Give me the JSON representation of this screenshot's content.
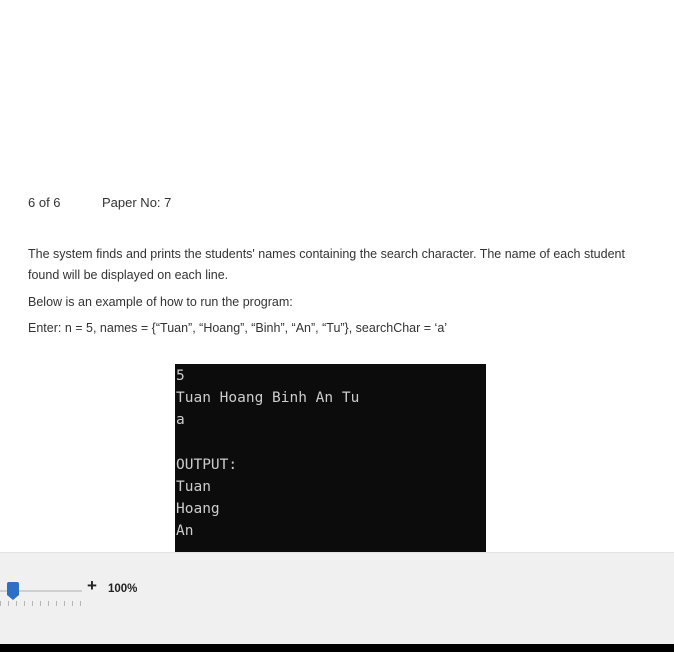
{
  "document": {
    "page_count": "6 of 6",
    "paper_no": "Paper No: 7",
    "description": "The system finds and prints the students' names containing the search character. The name of each student found will be displayed on each line.",
    "example_intro": "Below is an example of how to run the program:",
    "example_input": "Enter: n = 5, names = {“Tuan”, “Hoang”, “Binh”, “An”, “Tu”}, searchChar = ‘a’"
  },
  "console": {
    "lines": [
      "5",
      "Tuan Hoang Binh An Tu",
      "a",
      "",
      "OUTPUT:",
      "Tuan",
      "Hoang",
      "An"
    ],
    "background": "#0c0c0c",
    "text_color": "#cccccc"
  },
  "statusbar": {
    "zoom_plus": "+",
    "zoom_level": "100%",
    "zoom_percent": 100,
    "slider_color": "#2d6fc4"
  }
}
